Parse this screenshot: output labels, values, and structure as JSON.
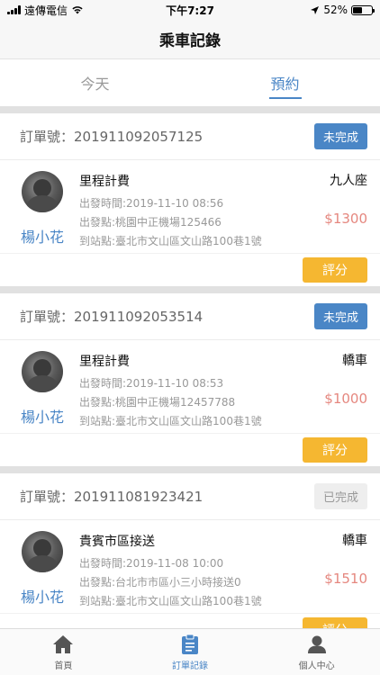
{
  "status_bar": {
    "carrier": "遠傳電信",
    "time": "下午7:27",
    "battery": "52%",
    "battery_level": 0.52
  },
  "nav": {
    "title": "乘車記錄"
  },
  "tabs": [
    {
      "label": "今天",
      "active": false
    },
    {
      "label": "預約",
      "active": true
    }
  ],
  "orders": [
    {
      "order_no": "訂單號：201911092057125",
      "status": "未完成",
      "status_kind": "pending",
      "driver_name": "楊小花",
      "trip_type": "里程計費",
      "depart_time": "出發時間:2019-11-10 08:56",
      "depart_from": "出發點:桃園中正機場125466",
      "arrive_at": "到站點:臺北市文山區文山路100巷1號",
      "vehicle": "九人座",
      "price": "$1300",
      "rate_label": "評分"
    },
    {
      "order_no": "訂單號：201911092053514",
      "status": "未完成",
      "status_kind": "pending",
      "driver_name": "楊小花",
      "trip_type": "里程計費",
      "depart_time": "出發時間:2019-11-10 08:53",
      "depart_from": "出發點:桃園中正機場12457788",
      "arrive_at": "到站點:臺北市文山區文山路100巷1號",
      "vehicle": "轎車",
      "price": "$1000",
      "rate_label": "評分"
    },
    {
      "order_no": "訂單號：201911081923421",
      "status": "已完成",
      "status_kind": "done",
      "driver_name": "楊小花",
      "trip_type": "貴賓市區接送",
      "depart_time": "出發時間:2019-11-08 10:00",
      "depart_from": "出發點:台北市市區小三小時接送0",
      "arrive_at": "到站點:臺北市文山區文山路100巷1號",
      "vehicle": "轎車",
      "price": "$1510",
      "rate_label": "評分"
    }
  ],
  "tab_bar": [
    {
      "label": "首頁",
      "icon": "home-icon",
      "active": false
    },
    {
      "label": "訂單記錄",
      "icon": "clipboard-icon",
      "active": true
    },
    {
      "label": "個人中心",
      "icon": "user-icon",
      "active": false
    }
  ],
  "colors": {
    "accent": "#4a86c6",
    "price": "#e5877f",
    "rate_button": "#f5b731",
    "done_badge": "#eeeeee"
  }
}
